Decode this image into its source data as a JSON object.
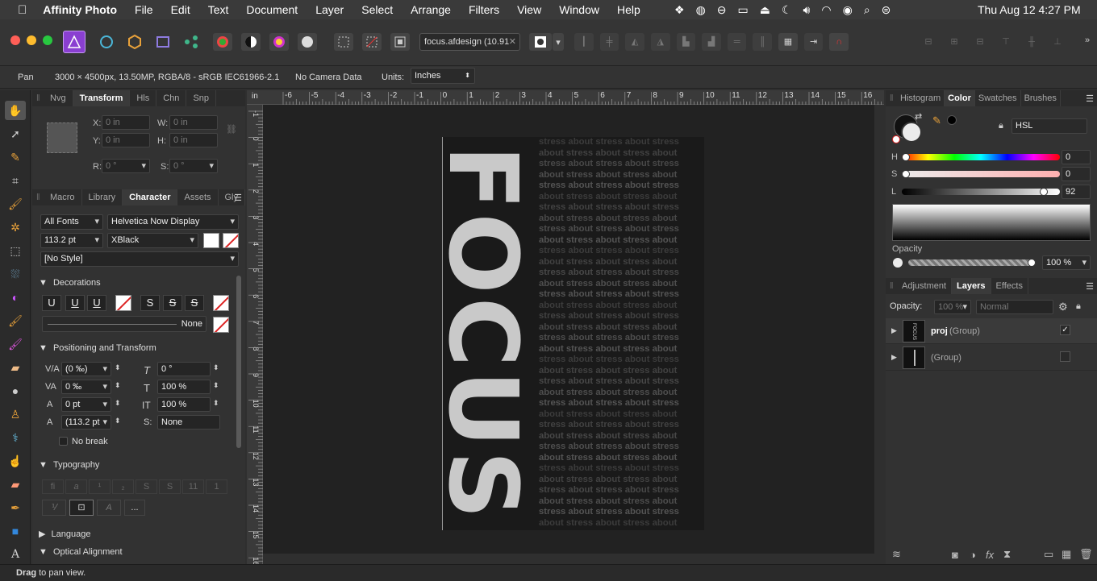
{
  "menubar": {
    "app_name": "Affinity Photo",
    "items": [
      "File",
      "Edit",
      "Text",
      "Document",
      "Layer",
      "Select",
      "Arrange",
      "Filters",
      "View",
      "Window",
      "Help"
    ],
    "clock": "Thu Aug 12  4:27 PM"
  },
  "toolbar": {
    "doc_tab": "focus.afdesign (10.9⁠1",
    "doc_tab_close": "✕"
  },
  "context": {
    "tool": "Pan",
    "doc_info": "3000 × 4500px, 13.50MP, RGBA/8 - sRGB IEC61966-2.1",
    "camera": "No Camera Data",
    "units_label": "Units:",
    "units_value": "Inches"
  },
  "transform_panel": {
    "tabs": [
      "Nvg",
      "Transform",
      "Hls",
      "Chn",
      "Snp"
    ],
    "active_tab": "Transform",
    "x_label": "X:",
    "x_value": "0 in",
    "y_label": "Y:",
    "y_value": "0 in",
    "w_label": "W:",
    "w_value": "0 in",
    "h_label": "H:",
    "h_value": "0 in",
    "r_label": "R:",
    "r_value": "0 °",
    "s_label": "S:",
    "s_value": "0 °"
  },
  "character_panel": {
    "tabs": [
      "Macro",
      "Library",
      "Character",
      "Assets",
      "Gly"
    ],
    "active_tab": "Character",
    "font_collection": "All Fonts",
    "font_family": "Helvetica Now Display",
    "font_size": "113.2 pt",
    "font_style": "XBlack",
    "para_style": "[No Style]",
    "decorations_title": "Decorations",
    "underline_buttons": [
      "U",
      "U",
      "U"
    ],
    "strike_buttons": [
      "S",
      "S",
      "S"
    ],
    "line_none": "None",
    "positioning_title": "Positioning and Transform",
    "kerning": "(0 ‰)",
    "tracking": "0 ‰",
    "baseline": "0 pt",
    "leading": "(113.2 pt",
    "shear": "0 °",
    "vscale": "100 %",
    "hscale": "100 %",
    "script": "None",
    "no_break": "No break",
    "typography_title": "Typography",
    "typo_more": "...",
    "language_title": "Language",
    "optical_title": "Optical Alignment"
  },
  "ruler": {
    "top_unit": "in",
    "top_ticks": [
      "-6",
      "-5",
      "-4",
      "-3",
      "-2",
      "-1",
      "0",
      "1",
      "2",
      "3",
      "4",
      "5",
      "6",
      "7",
      "8",
      "9",
      "10",
      "11",
      "12",
      "13",
      "14",
      "15",
      "16"
    ],
    "left_ticks": [
      "-1",
      "0",
      "1",
      "2",
      "3",
      "4",
      "5",
      "6",
      "7",
      "8",
      "9",
      "10",
      "11",
      "12",
      "13",
      "14",
      "15",
      "16"
    ]
  },
  "artwork": {
    "headline": "FOCUS",
    "pattern_line_a": "stress about stress about stress",
    "pattern_line_b": "about stress about stress about"
  },
  "color_panel": {
    "tabs": [
      "Histogram",
      "Color",
      "Swatches",
      "Brushes"
    ],
    "active_tab": "Color",
    "model": "HSL",
    "h_label": "H",
    "h_value": "0",
    "s_label": "S",
    "s_value": "0",
    "l_label": "L",
    "l_value": "92",
    "lightness": 0.92,
    "opacity_label": "Opacity",
    "opacity_value": "100 %",
    "opacity": 1.0
  },
  "layers_panel": {
    "tabs": [
      "Adjustment",
      "Layers",
      "Effects"
    ],
    "active_tab": "Layers",
    "opacity_label": "Opacity:",
    "opacity_value": "100 %",
    "blend_mode": "Normal",
    "layers": [
      {
        "name": "proj",
        "type": "(Group)",
        "thumb": "FOCUS",
        "checked": "✓"
      },
      {
        "name": "",
        "type": "(Group)",
        "thumb": "",
        "checked": ""
      }
    ]
  },
  "status": {
    "bold": "Drag",
    "text": " to pan view."
  },
  "colors": {
    "accent_app_icon": "#8a3fd1",
    "traffic_red": "#ff5f57",
    "traffic_yellow": "#febc2e",
    "traffic_green": "#28c840"
  }
}
